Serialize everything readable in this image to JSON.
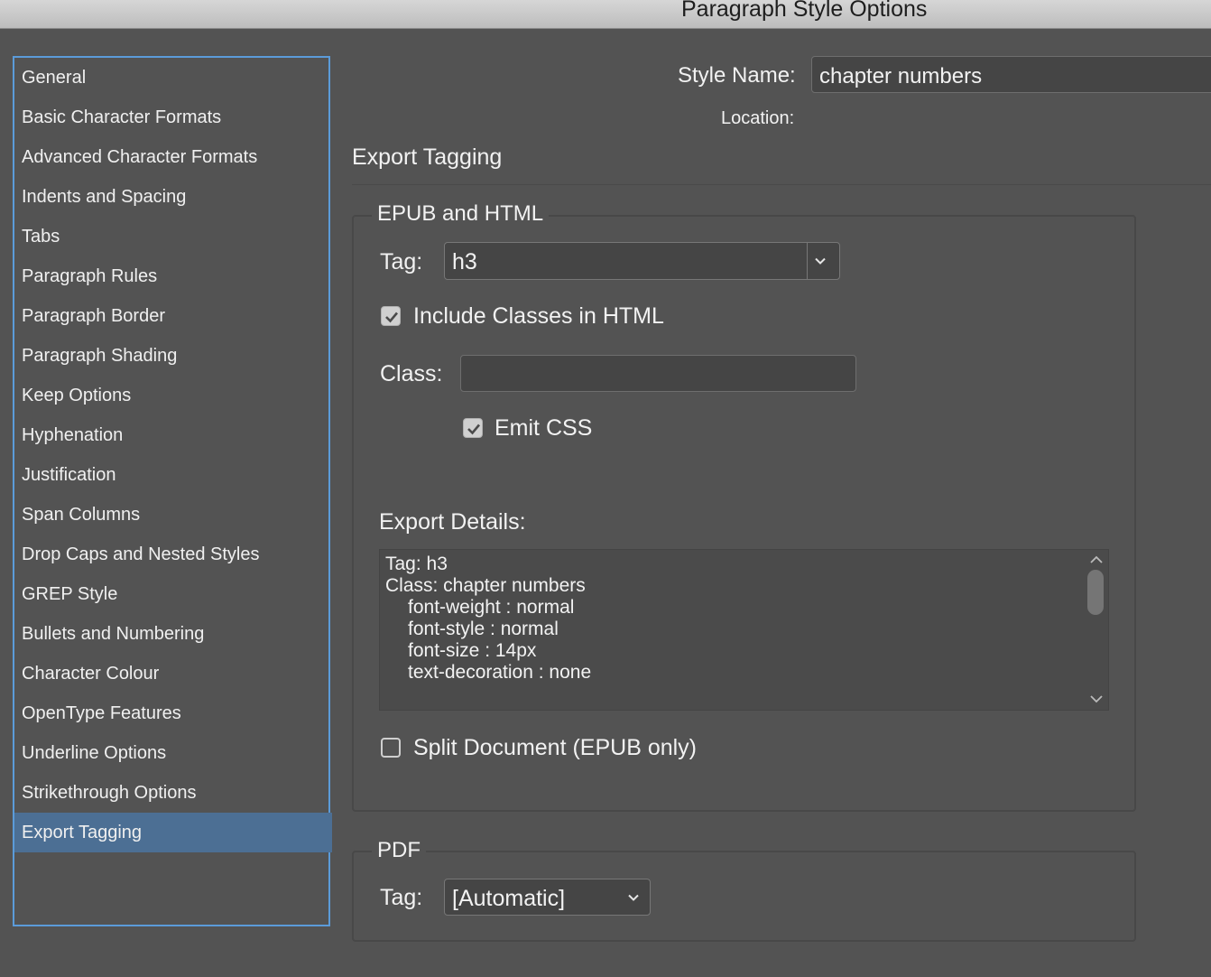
{
  "window": {
    "title": "Paragraph Style Options"
  },
  "sidebar": {
    "items": [
      "General",
      "Basic Character Formats",
      "Advanced Character Formats",
      "Indents and Spacing",
      "Tabs",
      "Paragraph Rules",
      "Paragraph Border",
      "Paragraph Shading",
      "Keep Options",
      "Hyphenation",
      "Justification",
      "Span Columns",
      "Drop Caps and Nested Styles",
      "GREP Style",
      "Bullets and Numbering",
      "Character Colour",
      "OpenType Features",
      "Underline Options",
      "Strikethrough Options",
      "Export Tagging"
    ],
    "selected": "Export Tagging"
  },
  "header": {
    "style_name_label": "Style Name:",
    "style_name_value": "chapter numbers",
    "location_label": "Location:"
  },
  "section": {
    "title": "Export Tagging"
  },
  "epub": {
    "group_title": "EPUB and HTML",
    "tag_label": "Tag:",
    "tag_value": "h3",
    "include_classes_label": "Include Classes in HTML",
    "include_classes_checked": true,
    "class_label": "Class:",
    "class_value": "",
    "emit_css_label": "Emit CSS",
    "emit_css_checked": true,
    "export_details_label": "Export Details:",
    "export_details_lines": [
      "Tag: h3",
      "Class: chapter numbers",
      "font-weight : normal",
      "font-style : normal",
      "font-size : 14px",
      "text-decoration : none"
    ],
    "split_label": "Split Document (EPUB only)",
    "split_checked": false
  },
  "pdf": {
    "group_title": "PDF",
    "tag_label": "Tag:",
    "tag_value": "[Automatic]"
  }
}
